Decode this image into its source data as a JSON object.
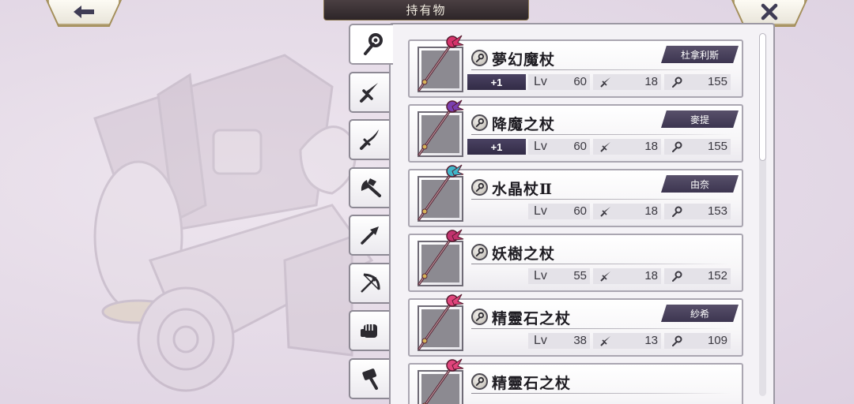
{
  "header": {
    "title": "持有物",
    "back_icon": "left-arrow-icon",
    "close_icon": "close-x-icon"
  },
  "tabs": [
    {
      "name": "staff",
      "icon": "staff-icon",
      "active": true
    },
    {
      "name": "sword",
      "icon": "sword-icon",
      "active": false
    },
    {
      "name": "katana",
      "icon": "katana-icon",
      "active": false
    },
    {
      "name": "axe",
      "icon": "axe-icon",
      "active": false
    },
    {
      "name": "spear",
      "icon": "spear-icon",
      "active": false
    },
    {
      "name": "bow",
      "icon": "bow-icon",
      "active": false
    },
    {
      "name": "fist",
      "icon": "fist-icon",
      "active": false
    },
    {
      "name": "hammer",
      "icon": "hammer-icon",
      "active": false
    }
  ],
  "stat_labels": {
    "level": "Lv"
  },
  "items": [
    {
      "name": "夢幻魔杖",
      "owner": "杜拿利斯",
      "refine": "+1",
      "level": "60",
      "attack": "18",
      "magic": "155",
      "gem": "#d6336b"
    },
    {
      "name": "降魔之杖",
      "owner": "麥提",
      "refine": "+1",
      "level": "60",
      "attack": "18",
      "magic": "155",
      "gem": "#7a3fb0"
    },
    {
      "name": "水晶杖Ⅱ",
      "owner": "由奈",
      "refine": "",
      "level": "60",
      "attack": "18",
      "magic": "153",
      "gem": "#3fb6c9"
    },
    {
      "name": "妖樹之杖",
      "owner": "",
      "refine": "",
      "level": "55",
      "attack": "18",
      "magic": "152",
      "gem": "#c2336e"
    },
    {
      "name": "精靈石之杖",
      "owner": "紗希",
      "refine": "",
      "level": "38",
      "attack": "13",
      "magic": "109",
      "gem": "#e0457c"
    },
    {
      "name": "精靈石之杖",
      "owner": "",
      "refine": "",
      "level": "",
      "attack": "",
      "magic": "",
      "gem": "#e0457c"
    }
  ],
  "colors": {
    "accent_dark": "#3c3550",
    "frame_gold": "#b6a57a",
    "panel_bg": "#f4f2f6"
  }
}
